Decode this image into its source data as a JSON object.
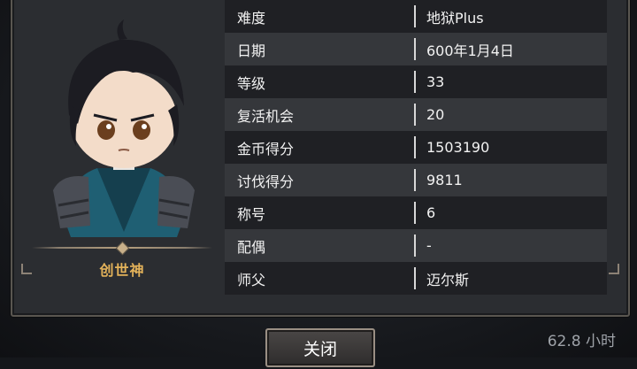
{
  "character": {
    "title": "创世神"
  },
  "stats": [
    {
      "label": "难度",
      "value": "地狱Plus"
    },
    {
      "label": "日期",
      "value": "600年1月4日"
    },
    {
      "label": "等级",
      "value": "33"
    },
    {
      "label": "复活机会",
      "value": "20"
    },
    {
      "label": "金币得分",
      "value": "1503190"
    },
    {
      "label": "讨伐得分",
      "value": "9811"
    },
    {
      "label": "称号",
      "value": "6"
    },
    {
      "label": "配偶",
      "value": "-"
    },
    {
      "label": "师父",
      "value": "迈尔斯"
    }
  ],
  "buttons": {
    "close_label": "关闭"
  },
  "footer": {
    "playtime": "62.8 小时"
  },
  "colors": {
    "title_gold": "#e3b25a",
    "panel_bg": "#2b2d31",
    "row_dark": "#1f2024",
    "row_light": "#35373b"
  }
}
